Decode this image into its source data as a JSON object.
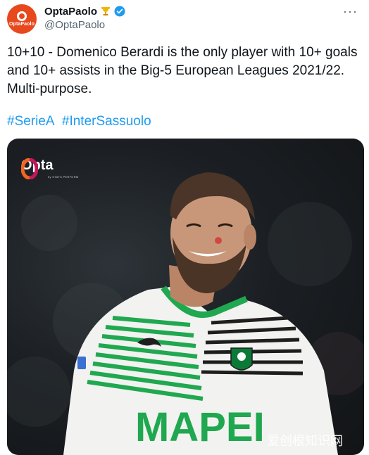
{
  "author": {
    "display_name": "OptaPaolo",
    "handle": "@OptaPaolo",
    "avatar_text": "OptaPaolo"
  },
  "tweet": {
    "text": "10+10 - Domenico Berardi is the only player with 10+ goals and 10+ assists in the Big-5 European Leagues 2021/22. Multi-purpose.",
    "hashtags": [
      "#SerieA",
      "#InterSassuolo"
    ]
  },
  "media": {
    "logo_text": "Opta",
    "logo_subtext": "by STATS PERFORM",
    "shirt_sponsor": "MAPEI",
    "watermark": "爱创根知识网"
  },
  "colors": {
    "link": "#1d9bf0",
    "verified": "#1d9bf0",
    "avatar_bg": "#e8481d",
    "shirt_green": "#1fa84f"
  }
}
